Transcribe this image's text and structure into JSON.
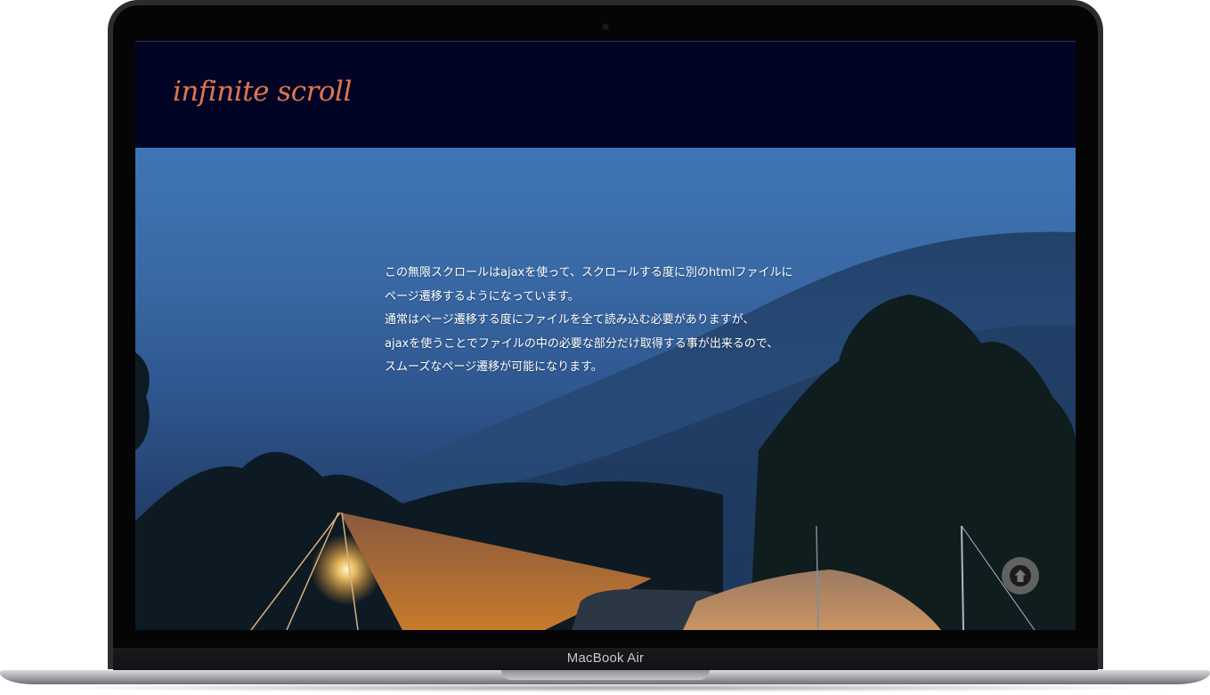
{
  "device": {
    "model_label": "MacBook Air"
  },
  "site": {
    "logo_text": "infinite scroll",
    "logo_color": "#e0764d",
    "header_bg": "#020426"
  },
  "hero": {
    "paragraph_lines": [
      "この無限スクロールはajaxを使って、スクロールする度に別のhtmlファイルに",
      "ページ遷移するようになっています。",
      "通常はページ遷移する度にファイルを全て読み込む必要がありますが、",
      "ajaxを使うことでファイルの中の必要な部分だけ取得する事が出来るので、",
      "スムーズなページ遷移が可能になります。"
    ],
    "image_subject": "foggy mountain campsite at dusk with lit tarp, tents and car",
    "sky_color": "#3f75b5"
  },
  "controls": {
    "scroll_top_icon": "arrow-up-icon"
  }
}
